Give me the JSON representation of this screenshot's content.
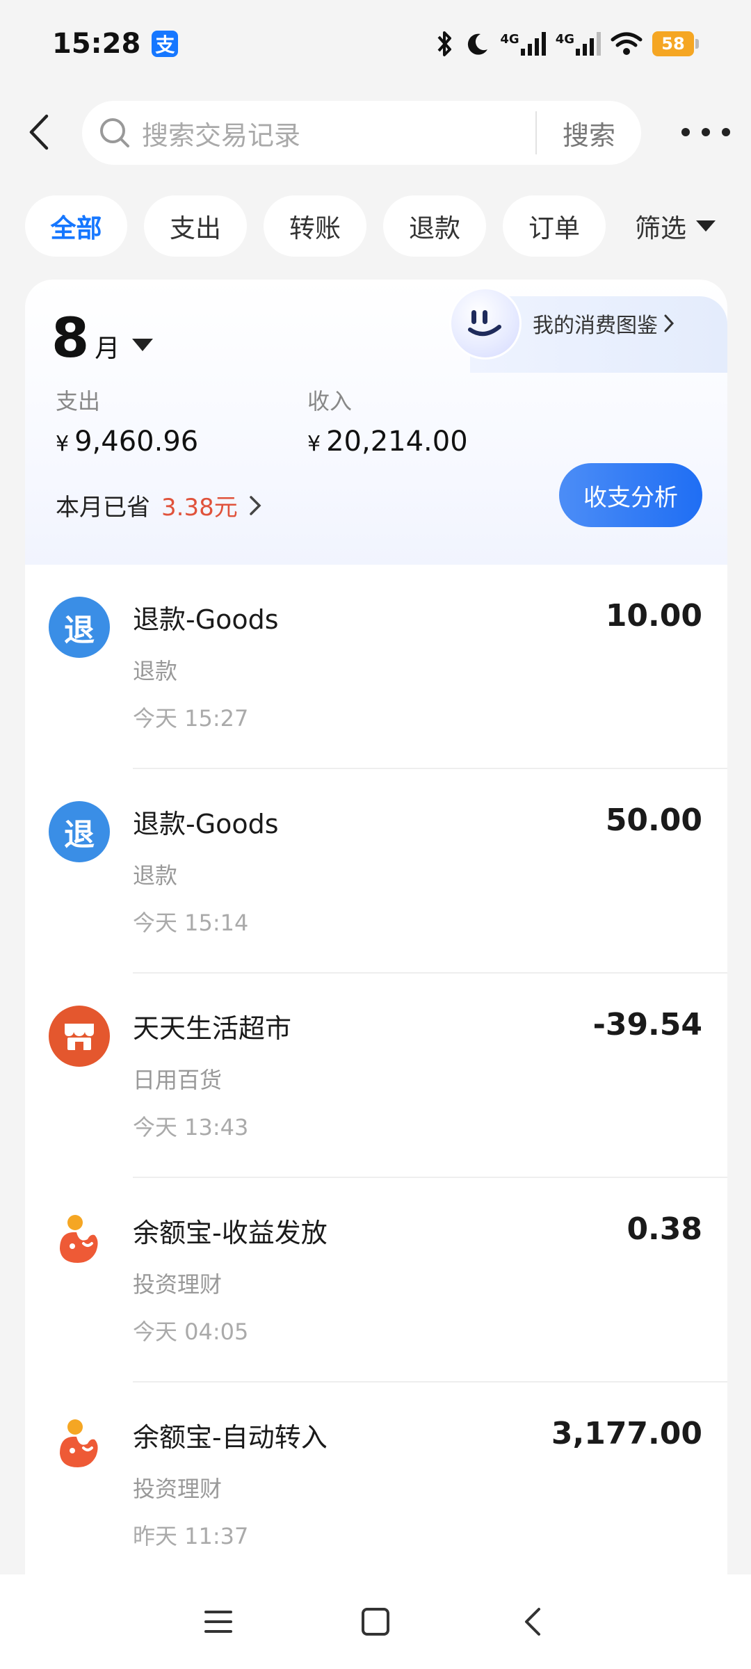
{
  "status_bar": {
    "time": "15:28",
    "app_icon_text": "支",
    "network_1": "4G",
    "network_2": "4G",
    "battery": "58"
  },
  "header": {
    "search_placeholder": "搜索交易记录",
    "search_button": "搜索"
  },
  "filters": {
    "chips": [
      "全部",
      "支出",
      "转账",
      "退款",
      "订单"
    ],
    "active_index": 0,
    "filter_label": "筛选"
  },
  "summary": {
    "month": "8",
    "month_unit": "月",
    "expense_label": "支出",
    "expense_value": "9,460.96",
    "income_label": "收入",
    "income_value": "20,214.00",
    "currency": "¥",
    "saved_label": "本月已省",
    "saved_amount": "3.38元",
    "atlas_label": "我的消费图鉴",
    "analysis_button": "收支分析"
  },
  "transactions": [
    {
      "title": "退款-Goods",
      "category": "退款",
      "time": "今天 15:27",
      "amount": "10.00",
      "icon": "refund-icon",
      "icon_text": "退",
      "icon_color": "#3a8ee6"
    },
    {
      "title": "退款-Goods",
      "category": "退款",
      "time": "今天 15:14",
      "amount": "50.00",
      "icon": "refund-icon",
      "icon_text": "退",
      "icon_color": "#3a8ee6"
    },
    {
      "title": "天天生活超市",
      "category": "日用百货",
      "time": "今天 13:43",
      "amount": "-39.54",
      "icon": "store-icon",
      "icon_text": "",
      "icon_color": "#e4572e"
    },
    {
      "title": "余额宝-收益发放",
      "category": "投资理财",
      "time": "今天 04:05",
      "amount": "0.38",
      "icon": "yuebao-icon",
      "icon_text": "",
      "icon_color": "#ee5a36"
    },
    {
      "title": "余额宝-自动转入",
      "category": "投资理财",
      "time": "昨天 11:37",
      "amount": "3,177.00",
      "icon": "yuebao-icon",
      "icon_text": "",
      "icon_color": "#ee5a36"
    }
  ]
}
